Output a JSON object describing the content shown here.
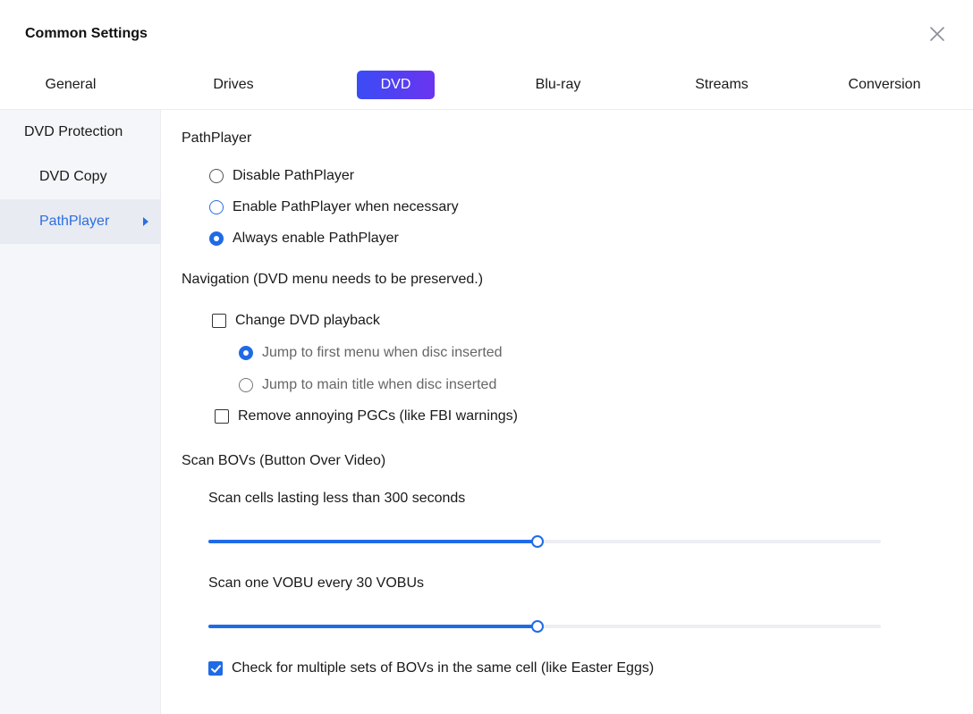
{
  "window": {
    "title": "Common Settings"
  },
  "tabs": [
    {
      "label": "General"
    },
    {
      "label": "Drives"
    },
    {
      "label": "DVD"
    },
    {
      "label": "Blu-ray"
    },
    {
      "label": "Streams"
    },
    {
      "label": "Conversion"
    }
  ],
  "active_tab": "DVD",
  "sidebar": {
    "items": [
      {
        "label": "DVD Protection"
      },
      {
        "label": "DVD Copy"
      },
      {
        "label": "PathPlayer"
      }
    ],
    "active": "PathPlayer"
  },
  "pathplayer": {
    "title": "PathPlayer",
    "options": [
      {
        "label": "Disable PathPlayer"
      },
      {
        "label": "Enable PathPlayer when necessary"
      },
      {
        "label": "Always enable PathPlayer"
      }
    ],
    "selected": "Always enable PathPlayer"
  },
  "navigation": {
    "title": "Navigation (DVD menu needs to be preserved.)",
    "change_playback": {
      "label": "Change DVD playback",
      "checked": false
    },
    "jump_options": [
      {
        "label": "Jump to first menu when disc inserted"
      },
      {
        "label": "Jump to main title when disc inserted"
      }
    ],
    "jump_selected": "Jump to first menu when disc inserted",
    "remove_pgcs": {
      "label": "Remove annoying PGCs (like FBI warnings)",
      "checked": false
    }
  },
  "scan_bovs": {
    "title": "Scan BOVs (Button Over Video)",
    "cells_label": "Scan cells lasting less than 300 seconds",
    "cells_slider_level": 0.49,
    "vobu_label": "Scan one VOBU every 30 VOBUs",
    "vobu_slider_level": 0.49,
    "multiple_sets": {
      "label": "Check for multiple sets of BOVs in the same cell (like Easter Eggs)",
      "checked": true
    }
  },
  "colors": {
    "accent": "#1f6be6",
    "tab_active_start": "#3a4cf5",
    "tab_active_end": "#6a34f0",
    "sidebar_bg": "#f5f6f9"
  },
  "icons": {
    "close": "close-icon",
    "active_arrow": "caret-right-icon",
    "check": "check-icon"
  }
}
